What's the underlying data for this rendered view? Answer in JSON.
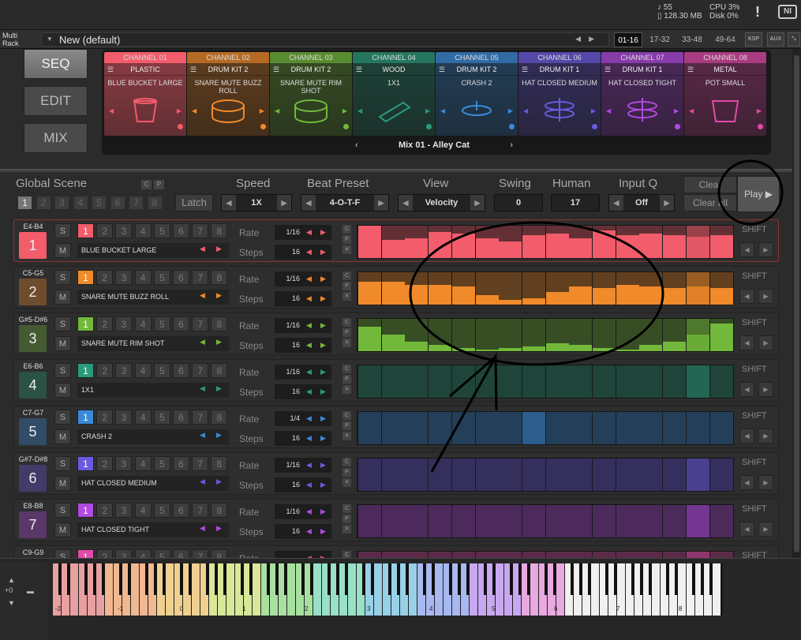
{
  "topbar": {
    "voices": "55",
    "memory": "128.30 MB",
    "cpu_label": "CPU",
    "cpu_value": "3%",
    "disk_label": "Disk",
    "disk_value": "0%",
    "warning": "!",
    "logo": "NI"
  },
  "rack": {
    "label_line1": "Multi",
    "label_line2": "Rack",
    "preset_name": "New (default)",
    "pages": [
      "01-16",
      "17-32",
      "33-48",
      "49-64"
    ],
    "ksp": "KSP",
    "aux": "AUX"
  },
  "nav": {
    "seq": "SEQ",
    "edit": "EDIT",
    "mix": "MIX"
  },
  "channels": [
    {
      "header": "CHANNEL 01",
      "kit": "PLASTIC",
      "sound": "BLUE BUCKET LARGE",
      "color": "#f25c6b",
      "icon": "bucket-icon"
    },
    {
      "header": "CHANNEL 02",
      "kit": "DRUM KIT 2",
      "sound": "SNARE MUTE BUZZ ROLL",
      "color": "#f08a2a",
      "icon": "snare-icon"
    },
    {
      "header": "CHANNEL 03",
      "kit": "DRUM KIT 2",
      "sound": "SNARE MUTE RIM SHOT",
      "color": "#72b83a",
      "icon": "snare-icon"
    },
    {
      "header": "CHANNEL 04",
      "kit": "WOOD",
      "sound": "1X1",
      "color": "#2a9a7a",
      "icon": "wood-block-icon"
    },
    {
      "header": "CHANNEL 05",
      "kit": "DRUM KIT 2",
      "sound": "CRASH 2",
      "color": "#3a8ad8",
      "icon": "cymbal-icon"
    },
    {
      "header": "CHANNEL 06",
      "kit": "DRUM KIT 1",
      "sound": "HAT CLOSED MEDIUM",
      "color": "#6a5ae0",
      "icon": "hihat-icon"
    },
    {
      "header": "CHANNEL 07",
      "kit": "DRUM KIT 1",
      "sound": "HAT CLOSED TIGHT",
      "color": "#b04ae0",
      "icon": "hihat-icon"
    },
    {
      "header": "CHANNEL 08",
      "kit": "METAL",
      "sound": "POT SMALL",
      "color": "#e04aa8",
      "icon": "pot-icon"
    }
  ],
  "mix_name": "Mix 01 - Alley Cat",
  "global": {
    "global_scene": "Global Scene",
    "c": "C",
    "p": "P",
    "scenes": [
      "1",
      "2",
      "3",
      "4",
      "5",
      "6",
      "7",
      "8"
    ],
    "latch": "Latch",
    "speed_label": "Speed",
    "speed_value": "1X",
    "beat_preset_label": "Beat Preset",
    "beat_preset_value": "4-O-T-F",
    "view_label": "View",
    "view_value": "Velocity",
    "swing_label": "Swing",
    "swing_value": "0",
    "human_label": "Human",
    "human_value": "17",
    "inputq_label": "Input Q",
    "inputq_value": "Off",
    "clear1": "Clear",
    "clear2": "Clear all",
    "play": "Play"
  },
  "track_labels": {
    "s": "S",
    "m": "M",
    "rate": "Rate",
    "steps": "Steps",
    "c": "C",
    "p": "P",
    "x": "✕",
    "shift": "SHIFT",
    "patterns": [
      "1",
      "2",
      "3",
      "4",
      "5",
      "6",
      "7",
      "8"
    ]
  },
  "tracks": [
    {
      "range": "E4-B4",
      "number": "1",
      "name": "BLUE BUCKET LARGE",
      "rate": "1/16",
      "steps": "16",
      "color": "#f25c6b",
      "velocities": [
        1.0,
        0.55,
        0.6,
        0.8,
        0.75,
        0.6,
        0.5,
        0.7,
        0.75,
        0.6,
        0.85,
        0.7,
        0.75,
        0.7,
        0.65,
        0.7
      ],
      "playhead": 14
    },
    {
      "range": "C5-G5",
      "number": "2",
      "name": "SNARE MUTE BUZZ ROLL",
      "rate": "1/16",
      "steps": "16",
      "color": "#f08a2a",
      "velocities": [
        0.7,
        0.7,
        0.6,
        0.6,
        0.55,
        0.3,
        0.15,
        0.2,
        0.4,
        0.55,
        0.5,
        0.6,
        0.55,
        0.5,
        0.55,
        0.5
      ],
      "playhead": 14
    },
    {
      "range": "G#5-D#6",
      "number": "3",
      "name": "SNARE MUTE RIM SHOT",
      "rate": "1/16",
      "steps": "16",
      "color": "#72b83a",
      "velocities": [
        0.75,
        0.5,
        0.3,
        0.2,
        0.1,
        0.05,
        0.1,
        0.15,
        0.25,
        0.2,
        0.1,
        0.05,
        0.2,
        0.3,
        0.5,
        0.85
      ],
      "playhead": 14
    },
    {
      "range": "E6-B6",
      "number": "4",
      "name": "1X1",
      "rate": "1/16",
      "steps": "16",
      "color": "#2a9a7a",
      "velocities": [
        0,
        0,
        0,
        0,
        0,
        0,
        0,
        0,
        0,
        0,
        0,
        0,
        0,
        0,
        0,
        0
      ],
      "playhead": 14
    },
    {
      "range": "C7-G7",
      "number": "5",
      "name": "CRASH 2",
      "rate": "1/4",
      "steps": "16",
      "color": "#3a8ad8",
      "velocities": [
        0,
        0,
        0,
        0,
        0,
        0,
        0,
        0,
        0,
        0,
        0,
        0,
        0,
        0,
        0,
        0
      ],
      "playhead": 7
    },
    {
      "range": "G#7-D#8",
      "number": "6",
      "name": "HAT CLOSED MEDIUM",
      "rate": "1/16",
      "steps": "16",
      "color": "#6a5ae0",
      "velocities": [
        0,
        0,
        0,
        0,
        0,
        0,
        0,
        0,
        0,
        0,
        0,
        0,
        0,
        0,
        0,
        0
      ],
      "playhead": 14
    },
    {
      "range": "E8-B8",
      "number": "7",
      "name": "HAT CLOSED TIGHT",
      "rate": "1/16",
      "steps": "16",
      "color": "#b04ae0",
      "velocities": [
        0,
        0,
        0,
        0,
        0,
        0,
        0,
        0,
        0,
        0,
        0,
        0,
        0,
        0,
        0,
        0
      ],
      "playhead": 14
    },
    {
      "range": "C9-G9",
      "number": "8",
      "name": "",
      "rate": "",
      "steps": "",
      "color": "#e04aa8",
      "velocities": [
        0,
        0,
        0,
        0,
        0,
        0,
        0,
        0,
        0,
        0,
        0,
        0,
        0,
        0,
        0,
        0
      ],
      "playhead": 14
    }
  ],
  "keyboard": {
    "transpose": "+0",
    "octaves": [
      "-2",
      "-1",
      "0",
      "1",
      "2",
      "3",
      "4",
      "5",
      "6",
      "7",
      "8"
    ]
  }
}
